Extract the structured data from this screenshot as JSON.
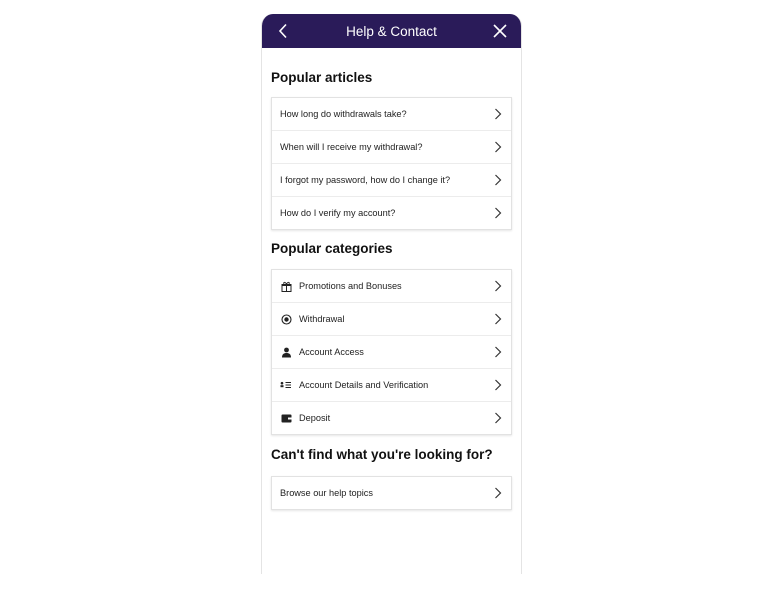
{
  "header": {
    "title": "Help & Contact",
    "back_icon": "chevron-left-icon",
    "close_icon": "close-icon"
  },
  "popular_articles": {
    "title": "Popular articles",
    "items": [
      {
        "label": "How long do withdrawals take?"
      },
      {
        "label": "When will I receive my withdrawal?"
      },
      {
        "label": "I forgot my password, how do I change it?"
      },
      {
        "label": "How do I verify my account?"
      }
    ]
  },
  "popular_categories": {
    "title": "Popular categories",
    "items": [
      {
        "label": "Promotions and Bonuses",
        "icon": "gift-icon"
      },
      {
        "label": "Withdrawal",
        "icon": "radio-target-icon"
      },
      {
        "label": "Account Access",
        "icon": "person-icon"
      },
      {
        "label": "Account Details and Verification",
        "icon": "id-card-icon"
      },
      {
        "label": "Deposit",
        "icon": "wallet-icon"
      }
    ]
  },
  "help_more": {
    "title": "Can't find what you're looking for?",
    "items": [
      {
        "label": "Browse our help topics"
      }
    ]
  },
  "colors": {
    "header_bg": "#2a1b59",
    "header_text": "#ffffff",
    "text": "#222222",
    "border": "#e2e2e2"
  }
}
